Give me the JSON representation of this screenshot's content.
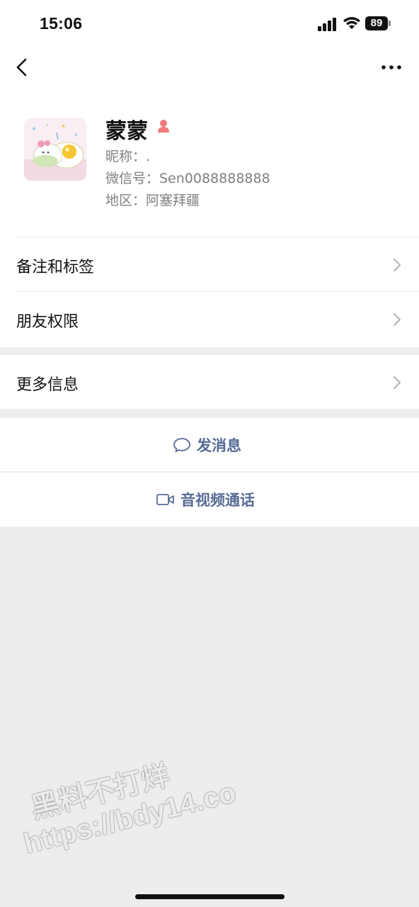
{
  "status_bar": {
    "time": "15:06",
    "battery": "89"
  },
  "profile": {
    "name": "蒙蒙",
    "nickname": "昵称：.",
    "wechat_id": "微信号：Sen0088888888",
    "region": "地区：阿塞拜疆"
  },
  "menu": {
    "remarks_tags": "备注和标签",
    "friend_permissions": "朋友权限",
    "more_info": "更多信息"
  },
  "actions": {
    "send_message": "发消息",
    "av_call": "音视频通话"
  },
  "watermark": {
    "line1": "黑料不打烊",
    "line2": "https://bdy14.co"
  },
  "colors": {
    "link_blue": "#576b95",
    "female_icon": "#f07b7b",
    "background_gray": "#ededed"
  },
  "icons": [
    "back-icon",
    "more-icon",
    "female-icon",
    "chevron-right-icon",
    "chat-bubble-icon",
    "video-camera-icon"
  ]
}
